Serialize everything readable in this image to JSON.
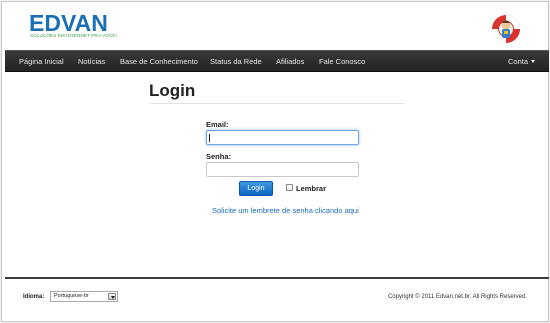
{
  "header": {
    "brand_name": "EDVAN",
    "brand_slogan": "SOLUÇÕES EM INTERNET PRA VOCÊ!"
  },
  "nav": {
    "items": [
      {
        "label": "Página Inicial"
      },
      {
        "label": "Notícias"
      },
      {
        "label": "Base de Conhecimento"
      },
      {
        "label": "Status da Rede"
      },
      {
        "label": "Afiliados"
      },
      {
        "label": "Fale Conosco"
      }
    ],
    "account_label": "Conta"
  },
  "login": {
    "title": "Login",
    "email_label": "Email:",
    "email_value": "",
    "password_label": "Senha:",
    "password_value": "",
    "submit_label": "Login",
    "remember_label": "Lembrar",
    "remember_checked": false,
    "reminder_link": "Solicite um lembrete de senha clicando aqui"
  },
  "footer": {
    "language_label": "Idioma:",
    "language_selected": "Portuguese-br",
    "copyright": "Copyright © 2011 Edvan.net.br. All Rights Reserved."
  },
  "colors": {
    "brand_blue": "#1b6fb5",
    "brand_green": "#3aa24a",
    "navbar": "#2b2b2b",
    "button": "#1a74d0",
    "link": "#1a6cc0"
  }
}
